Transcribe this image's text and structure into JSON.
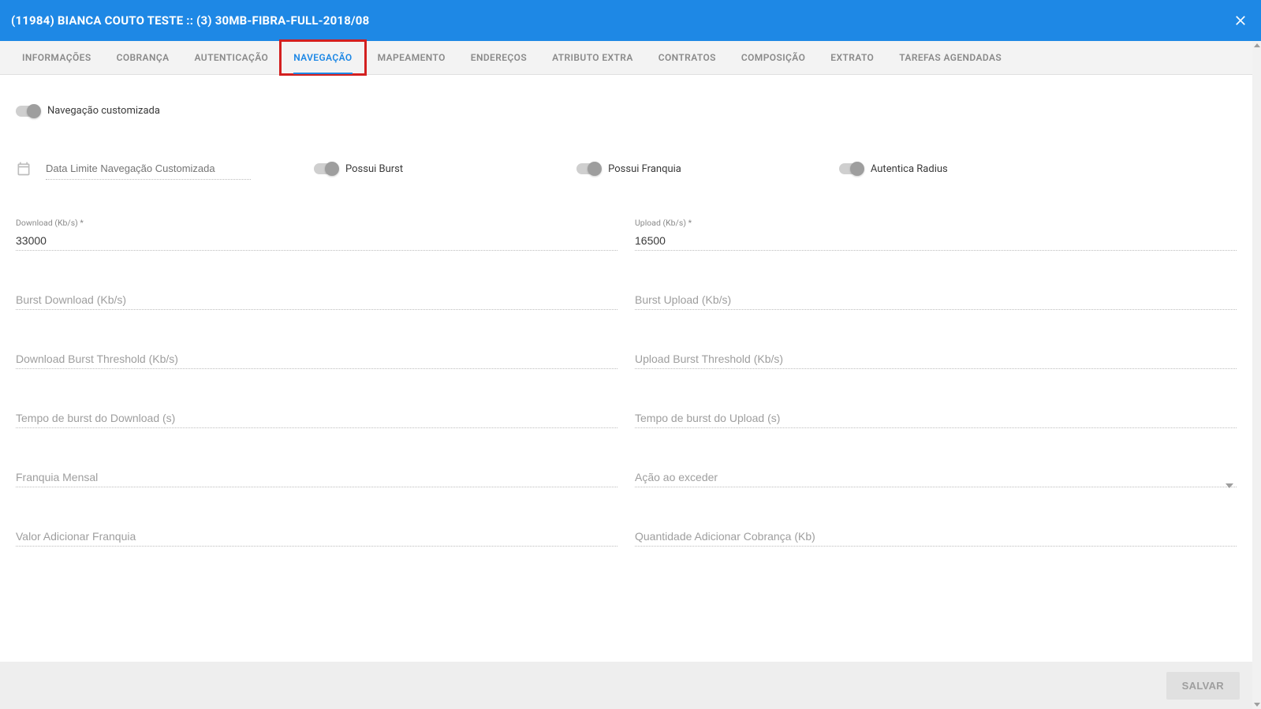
{
  "header": {
    "title": "(11984) BIANCA COUTO TESTE :: (3) 30MB-FIBRA-FULL-2018/08"
  },
  "tabs": [
    {
      "label": "INFORMAÇÕES"
    },
    {
      "label": "COBRANÇA"
    },
    {
      "label": "AUTENTICAÇÃO"
    },
    {
      "label": "NAVEGAÇÃO",
      "active": true,
      "highlight": true
    },
    {
      "label": "MAPEAMENTO"
    },
    {
      "label": "ENDEREÇOS"
    },
    {
      "label": "ATRIBUTO EXTRA"
    },
    {
      "label": "CONTRATOS"
    },
    {
      "label": "COMPOSIÇÃO"
    },
    {
      "label": "EXTRATO"
    },
    {
      "label": "TAREFAS AGENDADAS"
    }
  ],
  "toggles": {
    "custom_nav_label": "Navegação customizada",
    "possui_burst_label": "Possui Burst",
    "possui_franquia_label": "Possui Franquia",
    "autentica_radius_label": "Autentica Radius"
  },
  "date_field_placeholder": "Data Limite Navegação Customizada",
  "fields": {
    "download": {
      "label": "Download (Kb/s) *",
      "value": "33000"
    },
    "upload": {
      "label": "Upload (Kb/s) *",
      "value": "16500"
    },
    "burst_download_placeholder": "Burst Download (Kb/s)",
    "burst_upload_placeholder": "Burst Upload (Kb/s)",
    "dl_burst_threshold_placeholder": "Download Burst Threshold (Kb/s)",
    "ul_burst_threshold_placeholder": "Upload Burst Threshold (Kb/s)",
    "tempo_burst_dl_placeholder": "Tempo de burst do Download (s)",
    "tempo_burst_ul_placeholder": "Tempo de burst do Upload (s)",
    "franquia_mensal_placeholder": "Franquia Mensal",
    "acao_exceder_placeholder": "Ação ao exceder",
    "valor_adicionar_franquia_placeholder": "Valor Adicionar Franquia",
    "quantidade_adicionar_cobranca_placeholder": "Quantidade Adicionar Cobrança (Kb)"
  },
  "footer": {
    "save_label": "SALVAR"
  }
}
